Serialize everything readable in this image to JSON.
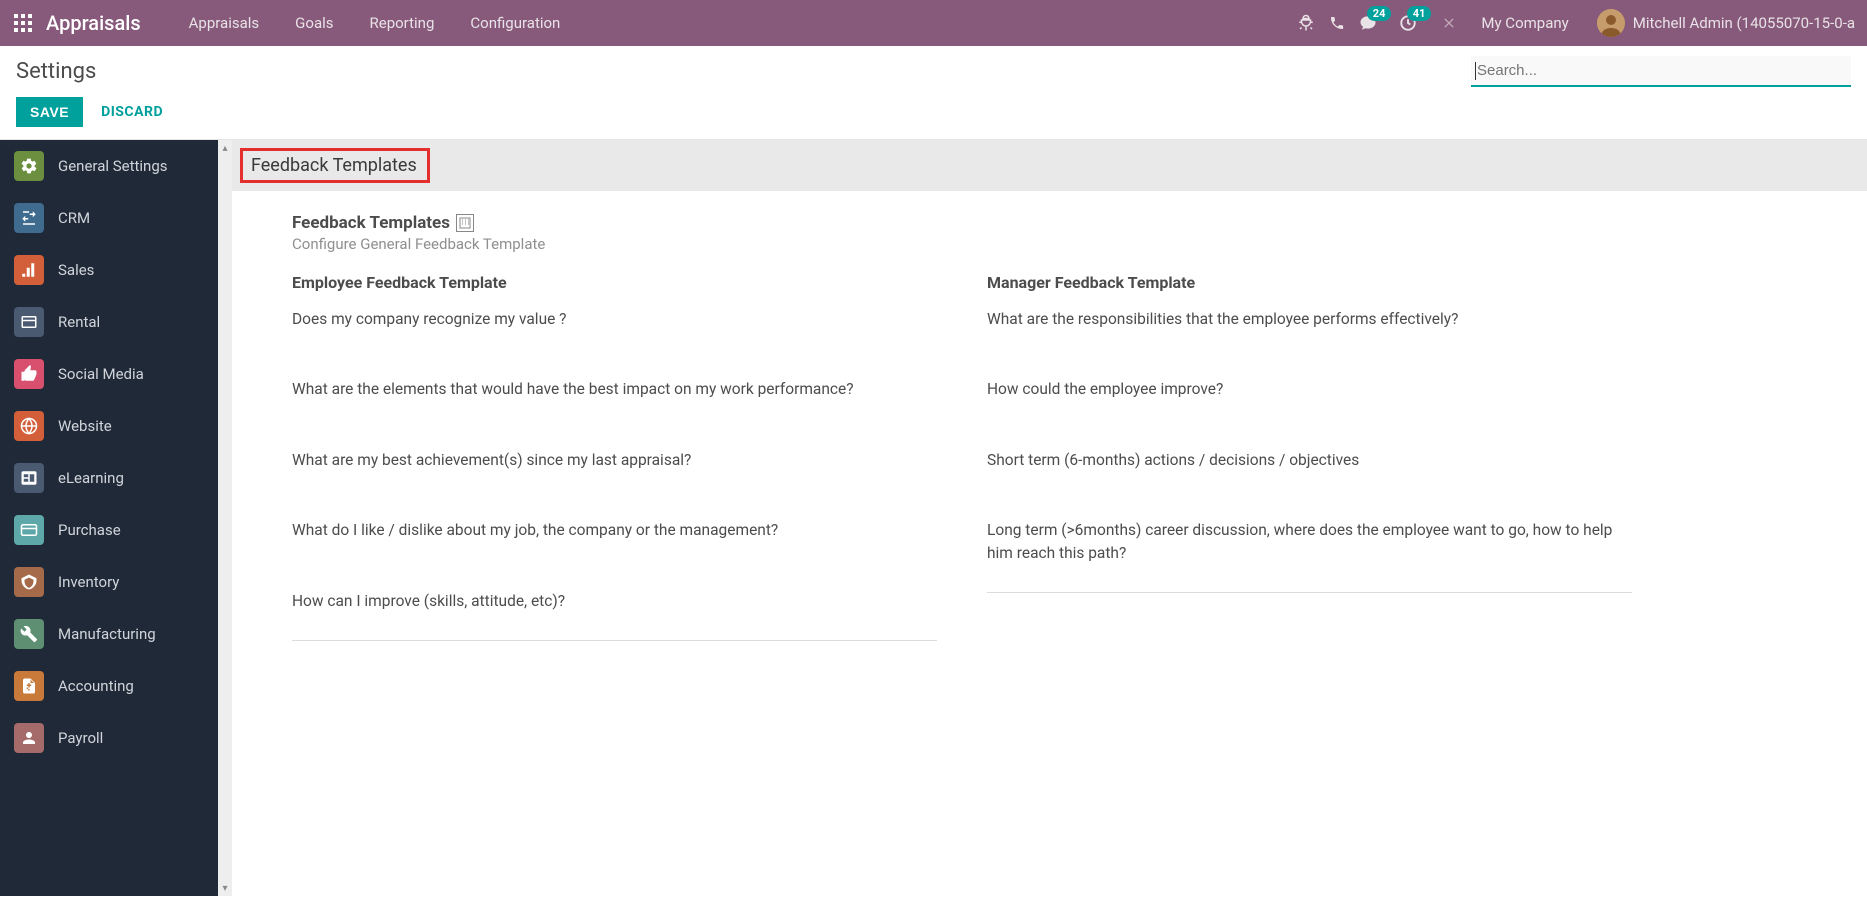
{
  "header": {
    "app_title": "Appraisals",
    "menu": [
      "Appraisals",
      "Goals",
      "Reporting",
      "Configuration"
    ],
    "badges": {
      "messages": "24",
      "activities": "41"
    },
    "company": "My Company",
    "user_name": "Mitchell Admin (14055070-15-0-a"
  },
  "control": {
    "breadcrumb": "Settings",
    "search_placeholder": "Search...",
    "save_label": "SAVE",
    "discard_label": "DISCARD"
  },
  "sidebar": {
    "items": [
      {
        "label": "General Settings",
        "color": "#6b8f3f"
      },
      {
        "label": "CRM",
        "color": "#3f6b8f"
      },
      {
        "label": "Sales",
        "color": "#d35f3a"
      },
      {
        "label": "Rental",
        "color": "#4a5a70"
      },
      {
        "label": "Social Media",
        "color": "#d94f6e"
      },
      {
        "label": "Website",
        "color": "#d35f3a"
      },
      {
        "label": "eLearning",
        "color": "#4a5a70"
      },
      {
        "label": "Purchase",
        "color": "#5fa8aa"
      },
      {
        "label": "Inventory",
        "color": "#a56a4a"
      },
      {
        "label": "Manufacturing",
        "color": "#5e8f72"
      },
      {
        "label": "Accounting",
        "color": "#c77a3a"
      },
      {
        "label": "Payroll",
        "color": "#a56a6a"
      }
    ]
  },
  "content": {
    "section_header": "Feedback Templates",
    "setting_title": "Feedback Templates",
    "setting_sub": "Configure General Feedback Template",
    "employee": {
      "header": "Employee Feedback Template",
      "questions": [
        "Does my company recognize my value ?",
        "What are the elements that would have the best impact on my work performance?",
        "What are my best achievement(s) since my last appraisal?",
        "What do I like / dislike about my job, the company or the management?",
        "How can I improve (skills, attitude, etc)?"
      ]
    },
    "manager": {
      "header": "Manager Feedback Template",
      "questions": [
        "What are the responsibilities that the employee performs effectively?",
        "How could the employee improve?",
        "Short term (6-months) actions / decisions / objectives",
        "Long term (>6months) career discussion, where does the employee want to go, how to help him reach this path?"
      ]
    }
  }
}
